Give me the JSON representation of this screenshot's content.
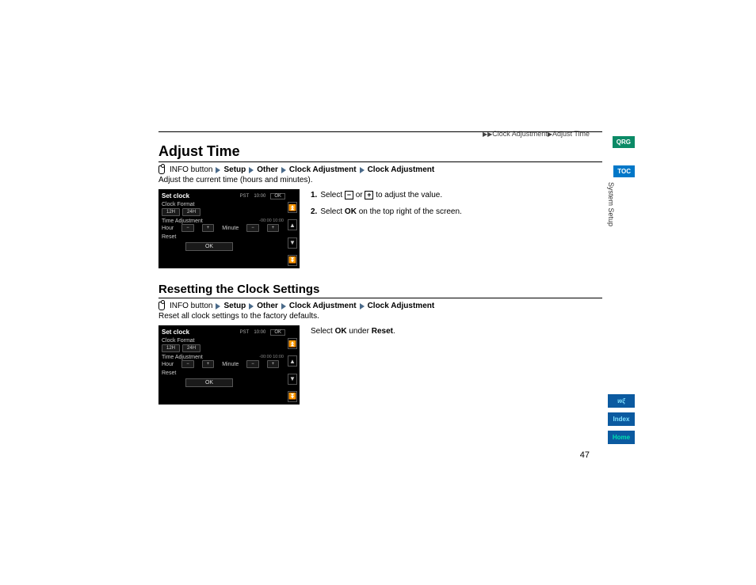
{
  "breadcrumb_top": {
    "seg1": "Clock Adjustment",
    "seg2": "Adjust Time"
  },
  "section1": {
    "title": "Adjust Time",
    "nav": {
      "info": "INFO button",
      "p1": "Setup",
      "p2": "Other",
      "p3": "Clock Adjustment",
      "p4": "Clock Adjustment"
    },
    "desc": "Adjust the current time (hours and minutes).",
    "step1_a": "Select",
    "step1_b": "or",
    "step1_c": "to adjust the value.",
    "step2_a": "Select",
    "step2_ok": "OK",
    "step2_b": "on the top right of the screen."
  },
  "section2": {
    "title": "Resetting the Clock Settings",
    "nav": {
      "info": "INFO button",
      "p1": "Setup",
      "p2": "Other",
      "p3": "Clock Adjustment",
      "p4": "Clock Adjustment"
    },
    "desc": "Reset all clock settings to the factory defaults.",
    "inst_a": "Select",
    "inst_ok": "OK",
    "inst_b": "under",
    "inst_reset": "Reset",
    "inst_c": "."
  },
  "device": {
    "title": "Set clock",
    "tz": "PST",
    "time": "10:00",
    "ok": "OK",
    "clock_format": "Clock Format",
    "h12": "12H",
    "h24": "24H",
    "time_adj": "Time Adjustment",
    "small_times": "-00:00  10:00",
    "hour": "Hour",
    "minute": "Minute",
    "minus": "−",
    "plus": "+",
    "reset": "Reset"
  },
  "sidebar": {
    "qrg": "QRG",
    "toc": "TOC",
    "section": "System Setup",
    "voice": "wξ",
    "index": "Index",
    "home": "Home"
  },
  "page_number": "47",
  "nums": {
    "n1": "1.",
    "n2": "2."
  },
  "glyphs": {
    "tri": "▶▶",
    "minus": "−",
    "plus": "+"
  }
}
